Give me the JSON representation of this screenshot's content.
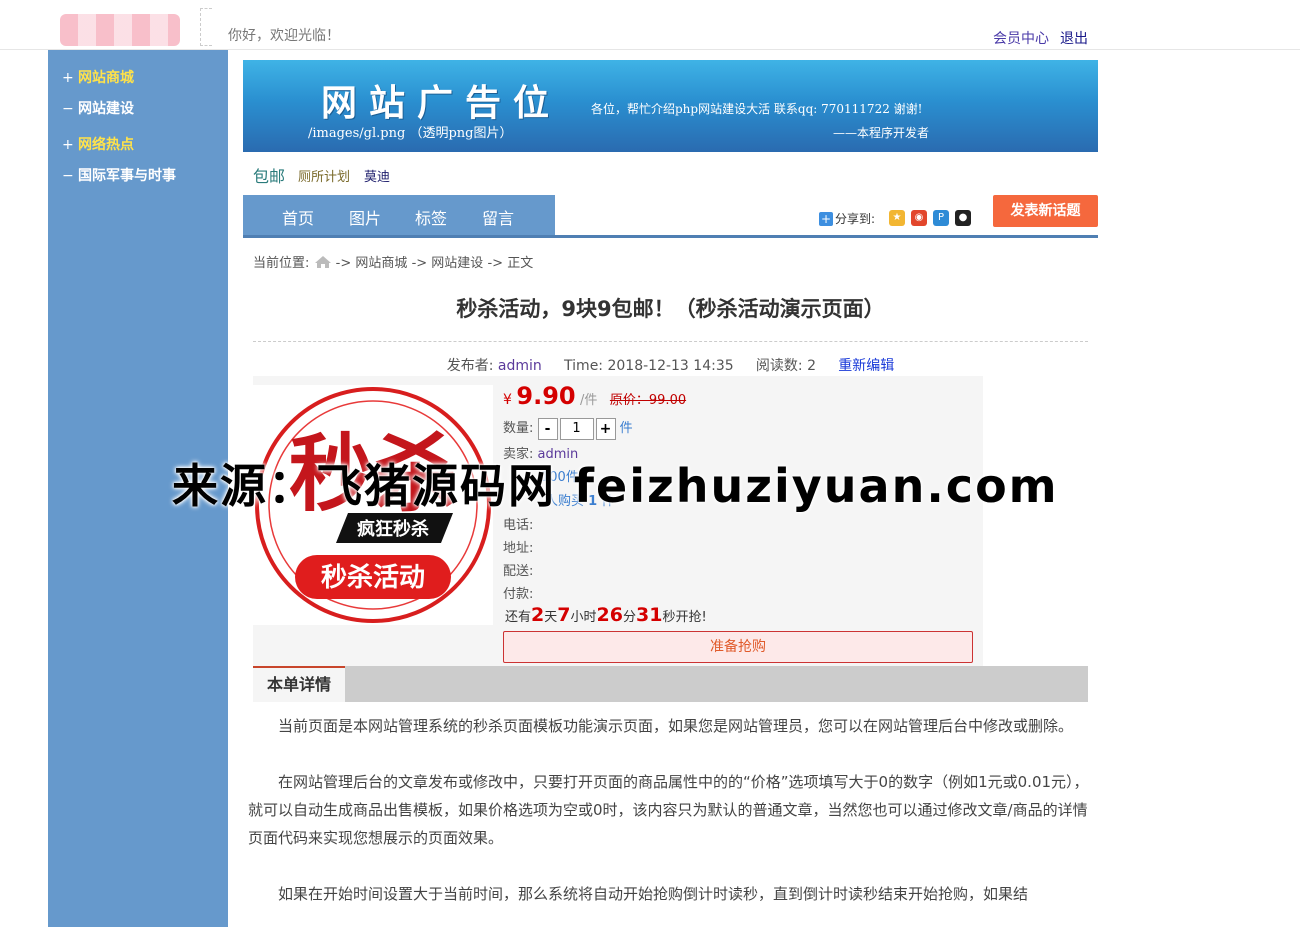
{
  "header": {
    "welcome": "你好，欢迎光临！",
    "member_center": "会员中心",
    "logout": "退出"
  },
  "sidebar": {
    "items": [
      {
        "marker": "+",
        "label": "网站商城"
      },
      {
        "marker": "−",
        "label": "网站建设"
      },
      {
        "marker": "+",
        "label": "网络热点"
      },
      {
        "marker": "−",
        "label": "国际军事与时事"
      }
    ]
  },
  "banner": {
    "title": "网站广告位",
    "path": "/images/gl.png （透明png图片）",
    "message": "各位，帮忙介绍php网站建设大活   联系qq: 770111722 谢谢!",
    "signature": "——本程序开发者"
  },
  "hot_links": [
    "包邮",
    "厕所计划",
    "莫迪"
  ],
  "nav": {
    "items": [
      "首页",
      "图片",
      "标签",
      "留言"
    ],
    "share_label": "分享到:",
    "post_button": "发表新话题"
  },
  "breadcrumb": {
    "prefix": "当前位置:",
    "sep": "->",
    "items": [
      "网站商城",
      "网站建设",
      "正文"
    ]
  },
  "article": {
    "title": "秒杀活动，9块9包邮！（秒杀活动演示页面）",
    "publisher_label": "发布者:",
    "publisher": "admin",
    "time": "Time: 2018-12-13 14:35",
    "views_label": "阅读数:",
    "views": "2",
    "edit": "重新编辑"
  },
  "product": {
    "image_text": {
      "big": "秒杀",
      "mid": "疯狂秒杀",
      "low": "秒杀活动"
    },
    "currency": "¥",
    "price": "9.90",
    "unit": "/件",
    "original": "原价：99.00",
    "qty_label": "数量:",
    "minus": "-",
    "qty": "1",
    "plus": "+",
    "qty_unit": "件",
    "seller_label": "卖家:",
    "seller": "admin",
    "stock_value": "100件",
    "buyers_text": "人购买",
    "buyers_count": "1",
    "buyers_unit": "件",
    "phone_label": "电话:",
    "address_label": "地址:",
    "delivery_label": "配送:",
    "payment_label": "付款:",
    "countdown": {
      "prefix": "还有",
      "days": "2",
      "days_unit": "天",
      "hours": "7",
      "hours_unit": "小时",
      "minutes": "26",
      "minutes_unit": "分",
      "seconds": "31",
      "seconds_unit": "秒开抢!"
    },
    "grab_button": "准备抢购"
  },
  "detail_tab": "本单详情",
  "content": {
    "paragraphs": [
      "当前页面是本网站管理系统的秒杀页面模板功能演示页面，如果您是网站管理员，您可以在网站管理后台中修改或删除。",
      "在网站管理后台的文章发布或修改中，只要打开页面的商品属性中的的“价格”选项填写大于0的数字（例如1元或0.01元），就可以自动生成商品出售模板，如果价格选项为空或0时，该内容只为默认的普通文章，当然您也可以通过修改文章/商品的详情页面代码来实现您想展示的页面效果。",
      "如果在开始时间设置大于当前时间，那么系统将自动开始抢购倒计时读秒，直到倒计时读秒结束开始抢购，如果结"
    ]
  },
  "watermark": "来源：飞猪源码网 feizhuziyuan.com",
  "colors": {
    "sidebar": "#6699cc",
    "accent_orange": "#f5683d",
    "price_red": "#d40000"
  }
}
